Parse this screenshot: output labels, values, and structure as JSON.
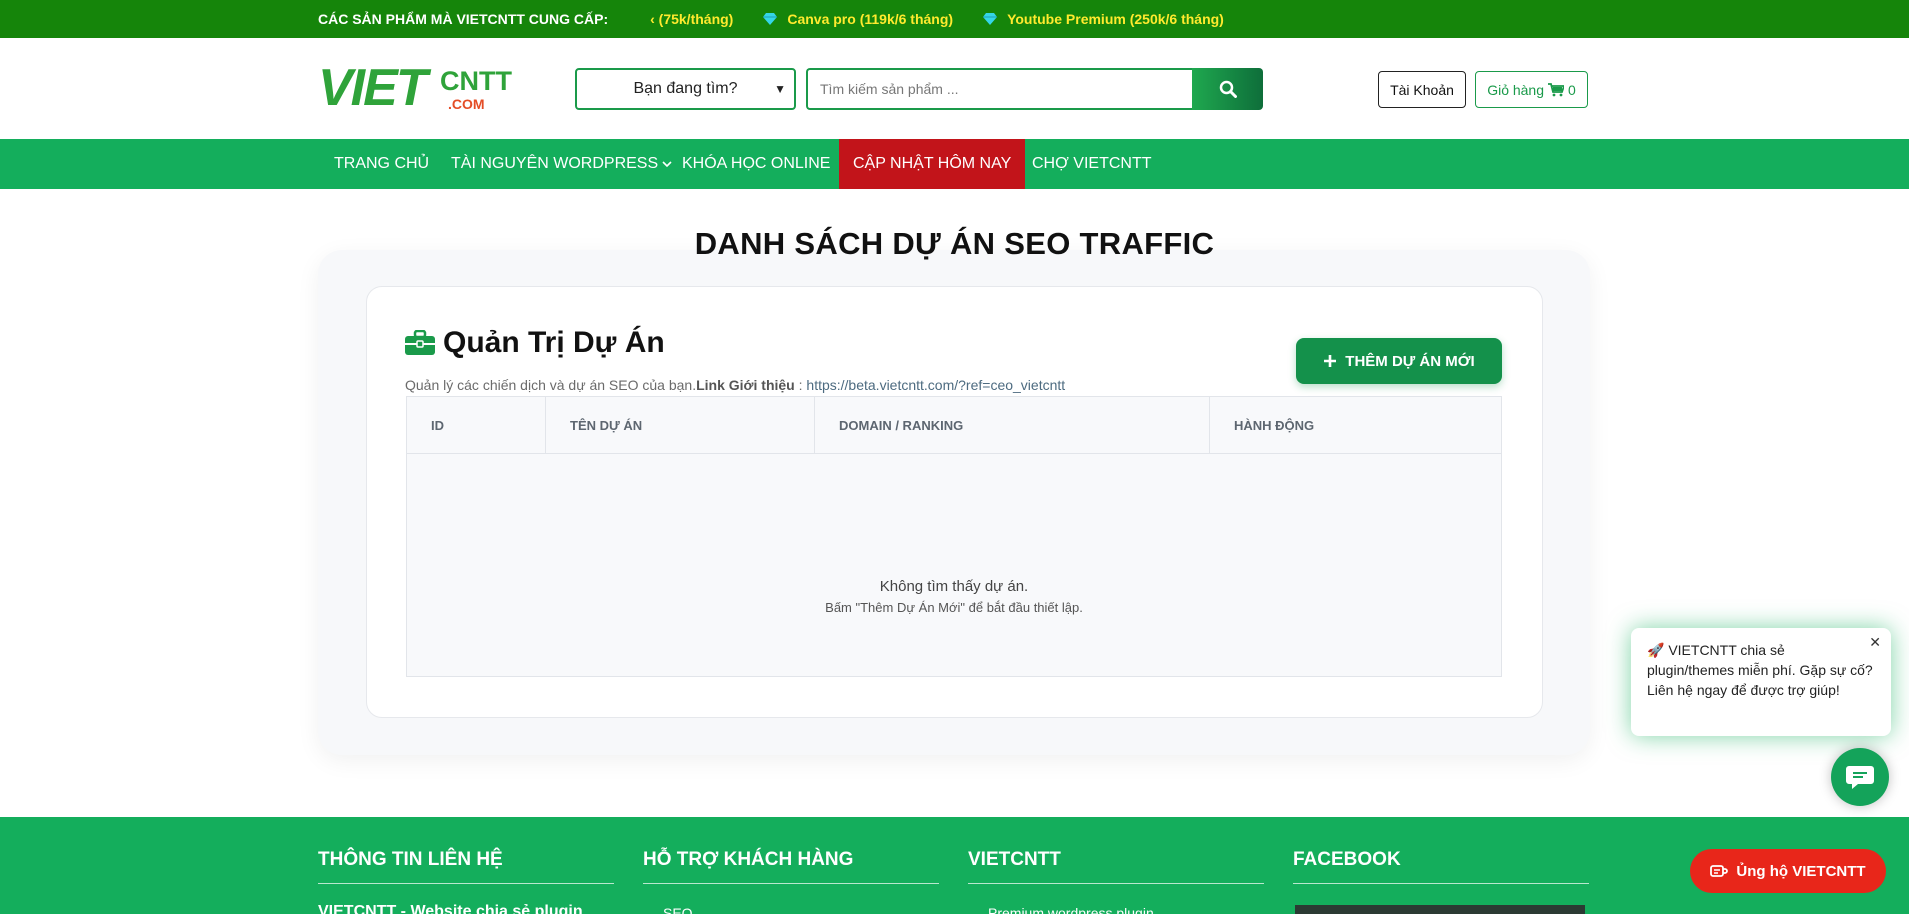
{
  "topbar": {
    "label": "CÁC SẢN PHẨM MÀ VIETCNTT CUNG CẤP:",
    "promos": [
      "‹ (75k/tháng)",
      "Canva pro (119k/6 tháng)",
      "Youtube Premium (250k/6 tháng)"
    ]
  },
  "header": {
    "logo": {
      "viet": "VIET",
      "cntt": "CNTT",
      "com": ".COM"
    },
    "category_select": "Bạn đang tìm?",
    "search_placeholder": "Tìm kiếm sản phẩm ...",
    "account_label": "Tài Khoản",
    "cart_label": "Giỏ hàng",
    "cart_count": "0"
  },
  "nav": {
    "items": [
      "TRANG CHỦ",
      "TÀI NGUYÊN WORDPRESS",
      "KHÓA HỌC ONLINE",
      "CẬP NHẬT HÔM NAY",
      "CHỢ VIETCNTT"
    ]
  },
  "main": {
    "page_title": "DANH SÁCH DỰ ÁN SEO TRAFFIC",
    "heading": "Quản Trị Dự Án",
    "subtext": "Quản lý các chiến dịch và dự án SEO của bạn.",
    "link_label": "Link Giới thiệu",
    "link_sep": " : ",
    "link_url": "https://beta.vietcntt.com/?ref=ceo_vietcntt",
    "add_button": "THÊM DỰ ÁN MỚI",
    "table": {
      "columns": [
        "ID",
        "TÊN DỰ ÁN",
        "DOMAIN / RANKING",
        "HÀNH ĐỘNG"
      ],
      "empty_title": "Không tìm thấy dự án.",
      "empty_hint": "Bấm \"Thêm Dự Án Mới\" để bắt đầu thiết lập."
    }
  },
  "footer": {
    "columns": [
      {
        "title": "THÔNG TIN LIÊN HỆ",
        "first": "VIETCNTT - Website chia sẻ plugin"
      },
      {
        "title": "HỖ TRỢ KHÁCH HÀNG",
        "first": "SEO"
      },
      {
        "title": "VIETCNTT",
        "first": "Premium wordpress plugin"
      },
      {
        "title": "FACEBOOK",
        "first": ""
      }
    ]
  },
  "widgets": {
    "chat_popup": "🚀 VIETCNTT chia sẻ plugin/themes miễn phí. Gặp sự cố? Liên hệ ngay để được trợ giúp!",
    "support_button": "Ủng hộ VIETCNTT"
  },
  "colors": {
    "topbar_bg": "#15850a",
    "nav_bg": "#14ae5c",
    "nav_active": "#c2141a",
    "promo_text": "#ffea2e",
    "primary_button": "#14914b",
    "support_button": "#e8261a"
  }
}
